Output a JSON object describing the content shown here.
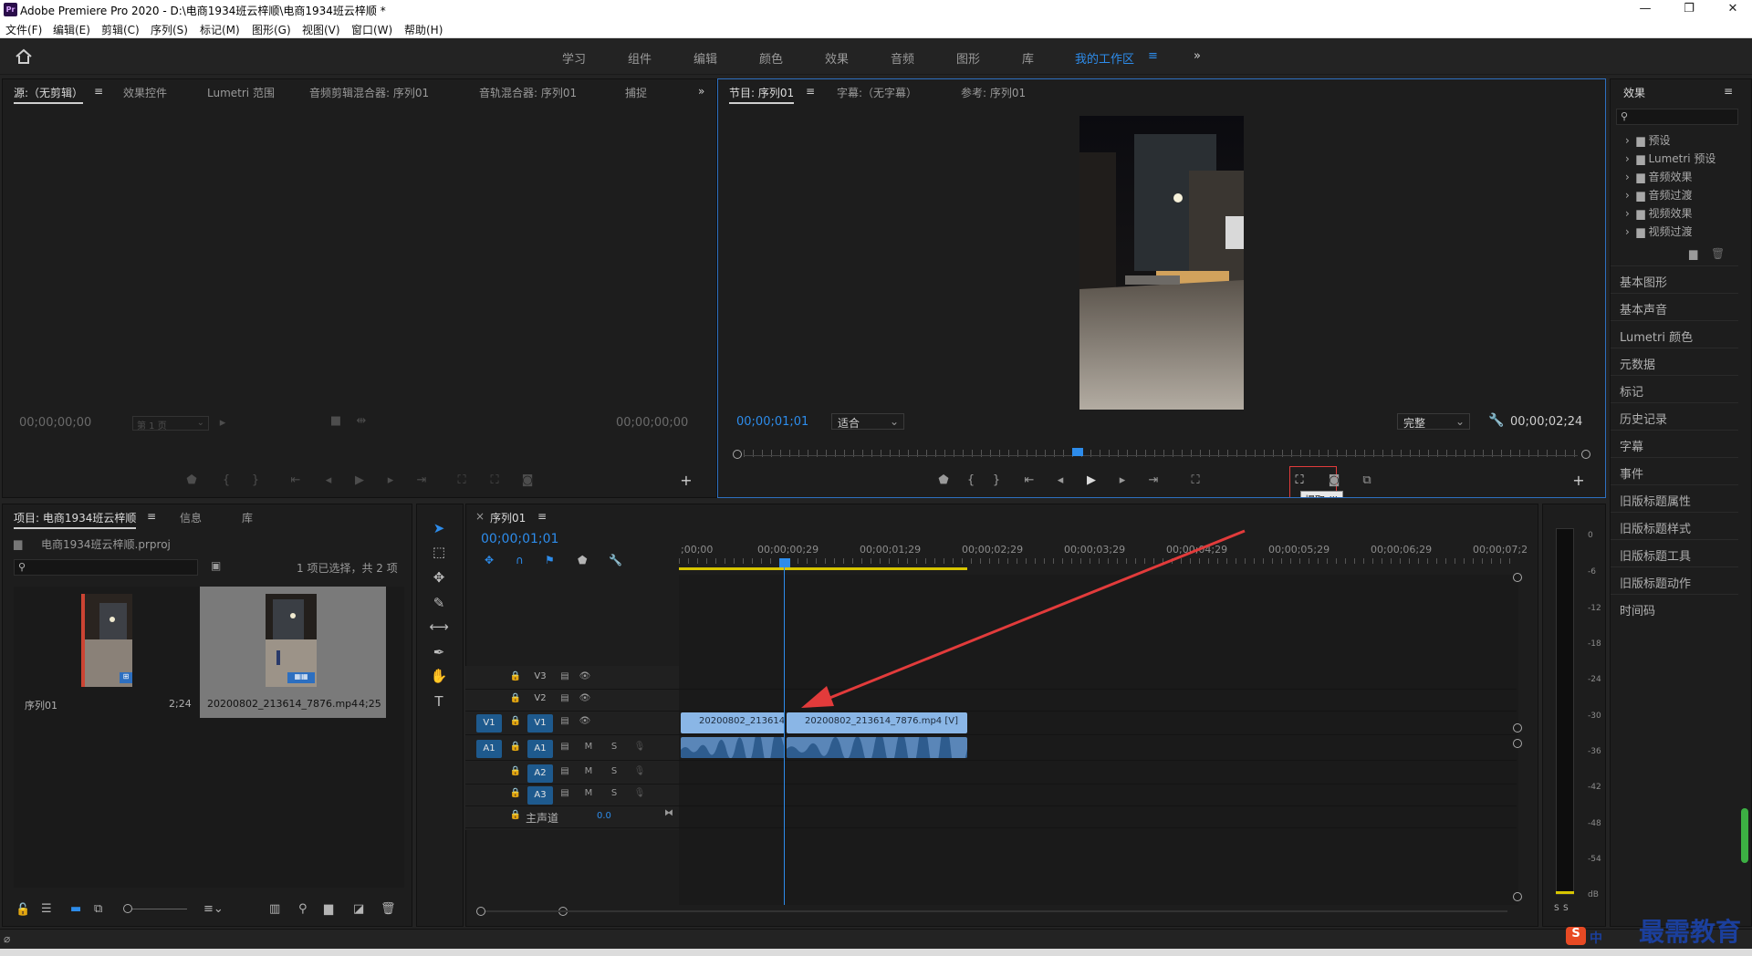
{
  "window": {
    "app_icon": "Pr",
    "title": "Adobe Premiere Pro 2020 - D:\\电商1934班云梓顺\\电商1934班云梓顺 *",
    "controls": [
      "—",
      "❐",
      "✕"
    ]
  },
  "menu": [
    "文件(F)",
    "编辑(E)",
    "剪辑(C)",
    "序列(S)",
    "标记(M)",
    "图形(G)",
    "视图(V)",
    "窗口(W)",
    "帮助(H)"
  ],
  "workspaces": {
    "items": [
      "学习",
      "组件",
      "编辑",
      "颜色",
      "效果",
      "音频",
      "图形",
      "库"
    ],
    "active": "我的工作区",
    "overflow": "»"
  },
  "source_panel": {
    "tabs": [
      "源:（无剪辑）",
      "效果控件",
      "Lumetri 范围",
      "音频剪辑混合器: 序列01",
      "音轨混合器: 序列01",
      "捕捉"
    ],
    "timecode_left": "00;00;00;00",
    "page": "第 1 页",
    "timecode_right": "00;00;00;00"
  },
  "program_panel": {
    "tabs": [
      "节目: 序列01",
      "字幕:（无字幕）",
      "参考: 序列01"
    ],
    "timecode": "00;00;01;01",
    "fit": "适合",
    "quality": "完整",
    "duration": "00;00;02;24",
    "tooltip": "提取 (')",
    "playhead_fraction": 0.4
  },
  "effects_panel": {
    "title": "效果",
    "tree": [
      "预设",
      "Lumetri 预设",
      "音频效果",
      "音频过渡",
      "视频效果",
      "视频过渡"
    ],
    "sections": [
      "基本图形",
      "基本声音",
      "Lumetri 颜色",
      "元数据",
      "标记",
      "历史记录",
      "字幕",
      "事件",
      "旧版标题属性",
      "旧版标题样式",
      "旧版标题工具",
      "旧版标题动作",
      "时间码"
    ]
  },
  "project_panel": {
    "tabs": [
      "项目: 电商1934班云梓顺",
      "信息",
      "库"
    ],
    "file": "电商1934班云梓顺.prproj",
    "selection": "1 项已选择，共 2 项",
    "items": [
      {
        "name": "序列01",
        "duration": "2;24"
      },
      {
        "name": "20200802_213614_7876.mp4",
        "duration": "4;25"
      }
    ]
  },
  "timeline": {
    "tab": "序列01",
    "timecode": "00;00;01;01",
    "ruler": [
      ";00;00",
      "00;00;00;29",
      "00;00;01;29",
      "00;00;02;29",
      "00;00;03;29",
      "00;00;04;29",
      "00;00;05;29",
      "00;00;06;29",
      "00;00;07;2"
    ],
    "tracks": {
      "video": [
        "V3",
        "V2",
        "V1"
      ],
      "audio": [
        "A1",
        "A2",
        "A3"
      ],
      "source_v": "V1",
      "source_a": "A1",
      "master": "主声道",
      "master_value": "0.0",
      "m": "M",
      "s": "S"
    },
    "clips": [
      {
        "label": "20200802_213614_",
        "track": "V1"
      },
      {
        "label": "20200802_213614_7876.mp4 [V]",
        "track": "V1"
      }
    ]
  },
  "meters": {
    "labels": [
      "0",
      "-6",
      "-12",
      "-18",
      "-24",
      "-30",
      "-36",
      "-42",
      "-48",
      "-54",
      "dB"
    ],
    "solo": [
      "S",
      "S"
    ]
  },
  "watermark": "最需教育",
  "ime": "中"
}
